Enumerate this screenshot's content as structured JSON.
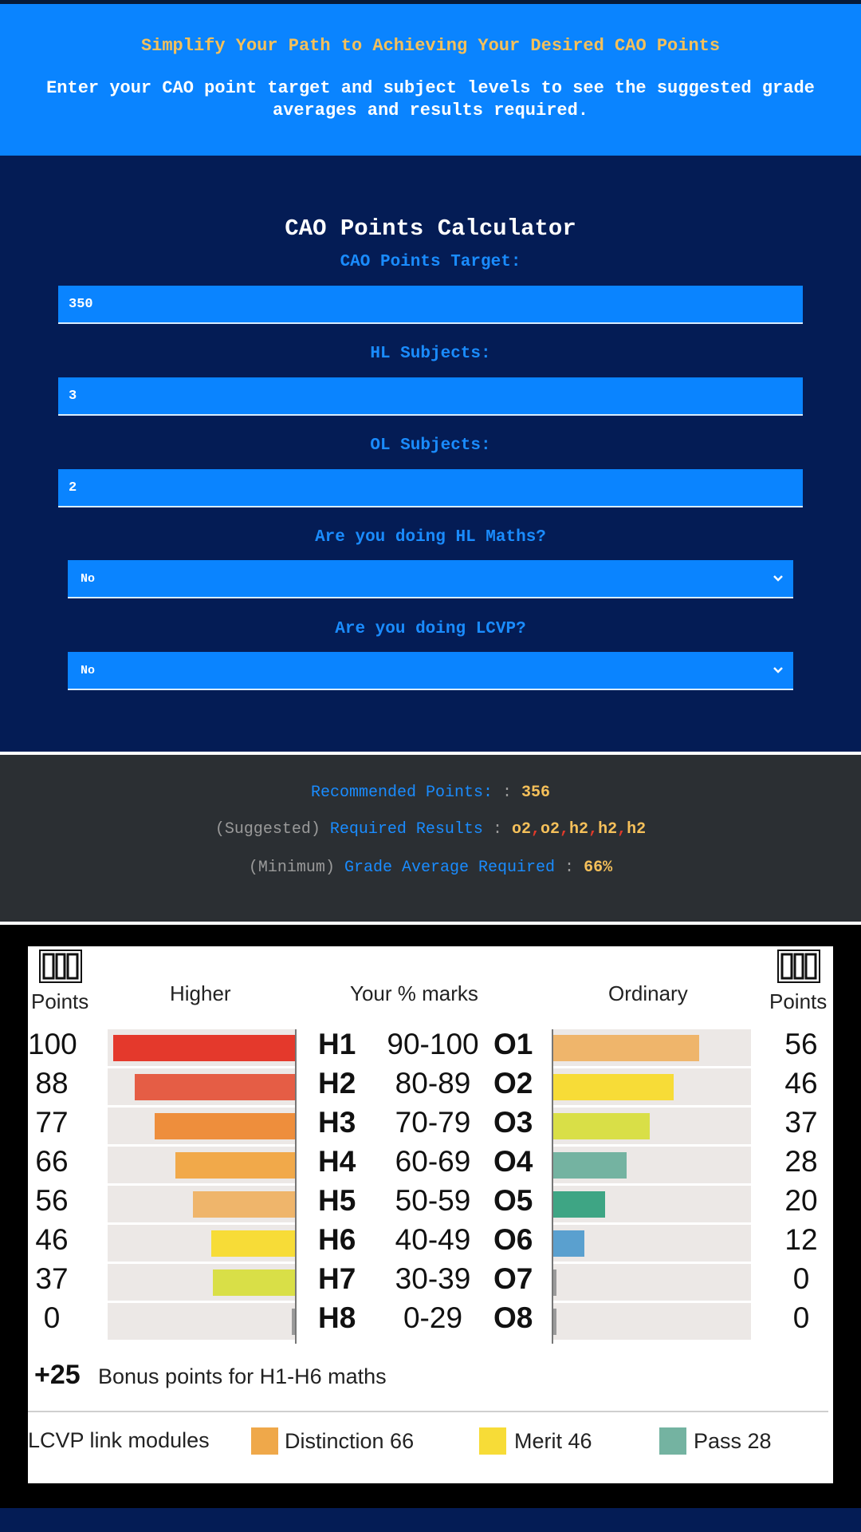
{
  "hero": {
    "title": "Simplify Your Path to Achieving Your Desired CAO Points",
    "subtitle": "Enter your CAO point target and subject levels to see the suggested grade averages and results required."
  },
  "calculator": {
    "title": "CAO Points Calculator",
    "fields": {
      "target_label": "CAO Points Target:",
      "target_value": "350",
      "hl_label": "HL Subjects:",
      "hl_value": "3",
      "ol_label": "OL Subjects:",
      "ol_value": "2",
      "maths_label": "Are you doing HL Maths?",
      "maths_value": "No",
      "lcvp_label": "Are you doing LCVP?",
      "lcvp_value": "No"
    }
  },
  "results": {
    "recommended_label": "Recommended Points:",
    "recommended_sep": ":",
    "recommended_value": "356",
    "required_prefix": "(Suggested)",
    "required_label": "Required Results",
    "required_sep": ":",
    "required_grades": [
      "o2",
      "o2",
      "h2",
      "h2",
      "h2"
    ],
    "required_comma": ",",
    "average_prefix": "(Minimum)",
    "average_label": "Grade Average Required",
    "average_sep": ":",
    "average_value": "66%"
  },
  "points_table": {
    "logo_text": "CAO",
    "col_points": "Points",
    "col_higher": "Higher",
    "col_marks": "Your % marks",
    "col_ordinary": "Ordinary",
    "col_points_right": "Points",
    "rows": [
      {
        "hl_points": "100",
        "hl_grade": "H1",
        "range": "90-100",
        "ol_grade": "O1",
        "ol_points": "56",
        "hl_fraction": 1.0,
        "ol_fraction": 0.56,
        "hl_color": "#e4392c",
        "ol_color": "#efb56b"
      },
      {
        "hl_points": "88",
        "hl_grade": "H2",
        "range": "80-89",
        "ol_grade": "O2",
        "ol_points": "46",
        "hl_fraction": 0.88,
        "ol_fraction": 0.46,
        "hl_color": "#e55d45",
        "ol_color": "#f7dc37"
      },
      {
        "hl_points": "77",
        "hl_grade": "H3",
        "range": "70-79",
        "ol_grade": "O3",
        "ol_points": "37",
        "hl_fraction": 0.77,
        "ol_fraction": 0.37,
        "hl_color": "#ee8e3c",
        "ol_color": "#d9df47"
      },
      {
        "hl_points": "66",
        "hl_grade": "H4",
        "range": "60-69",
        "ol_grade": "O4",
        "ol_points": "28",
        "hl_fraction": 0.66,
        "ol_fraction": 0.28,
        "hl_color": "#f1a94a",
        "ol_color": "#74b3a1"
      },
      {
        "hl_points": "56",
        "hl_grade": "H5",
        "range": "50-59",
        "ol_grade": "O5",
        "ol_points": "20",
        "hl_fraction": 0.56,
        "ol_fraction": 0.2,
        "hl_color": "#efb56b",
        "ol_color": "#3ea584"
      },
      {
        "hl_points": "46",
        "hl_grade": "H6",
        "range": "40-49",
        "ol_grade": "O6",
        "ol_points": "12",
        "hl_fraction": 0.46,
        "ol_fraction": 0.12,
        "hl_color": "#f7dc37",
        "ol_color": "#5aa0cf"
      },
      {
        "hl_points": "37",
        "hl_grade": "H7",
        "range": "30-39",
        "ol_grade": "O7",
        "ol_points": "0",
        "hl_fraction": 0.45,
        "ol_fraction": 0.01,
        "hl_color": "#d9df47",
        "ol_color": "#9a9a9a"
      },
      {
        "hl_points": "0",
        "hl_grade": "H8",
        "range": "0-29",
        "ol_grade": "O8",
        "ol_points": "0",
        "hl_fraction": 0.01,
        "ol_fraction": 0.01,
        "hl_color": "#9a9a9a",
        "ol_color": "#9a9a9a"
      }
    ],
    "bonus_value": "+25",
    "bonus_text": "Bonus points for H1-H6 maths",
    "lcvp_title": "LCVP link modules",
    "lcvp_items": [
      {
        "label": "Distinction 66",
        "color": "#efa84a"
      },
      {
        "label": "Merit 46",
        "color": "#f7dc37"
      },
      {
        "label": "Pass 28",
        "color": "#74b3a1"
      }
    ]
  }
}
